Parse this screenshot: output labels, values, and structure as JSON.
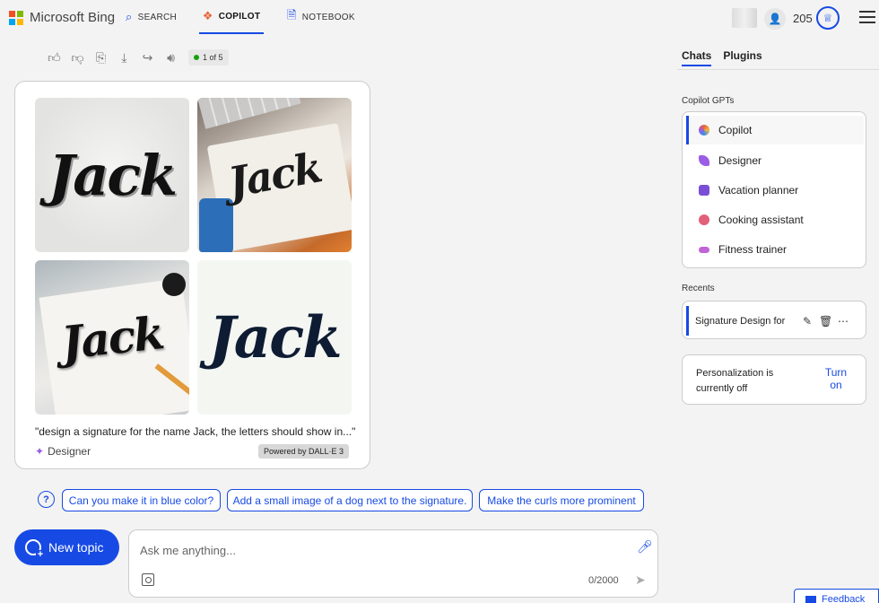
{
  "header": {
    "brand": "Microsoft Bing",
    "tabs": [
      {
        "label": "SEARCH",
        "icon": "search-icon"
      },
      {
        "label": "COPILOT",
        "icon": "copilot-icon",
        "active": true
      },
      {
        "label": "NOTEBOOK",
        "icon": "notebook-icon"
      }
    ],
    "points": "205",
    "accent_color": "#174ae4"
  },
  "response_actions": {
    "icons": [
      "thumbs-up-icon",
      "thumbs-down-icon",
      "copy-icon",
      "download-icon",
      "share-icon",
      "read-aloud-icon"
    ],
    "pager": "1 of 5"
  },
  "result_card": {
    "image_texts": [
      "Jack",
      "Jack",
      "Jack",
      "Jack"
    ],
    "prompt": "\"design a signature for the name Jack, the letters should show in...\"",
    "source": "Designer",
    "powered_by": "Powered by DALL·E 3"
  },
  "suggestions": [
    "Can you make it in blue color?",
    "Add a small image of a dog next to the signature.",
    "Make the curls more prominent"
  ],
  "composer": {
    "new_topic": "New topic",
    "placeholder": "Ask me anything...",
    "counter": "0/2000"
  },
  "sidebar": {
    "tabs": [
      "Chats",
      "Plugins"
    ],
    "gpts_title": "Copilot GPTs",
    "gpts": [
      {
        "label": "Copilot",
        "color": "#e8643c"
      },
      {
        "label": "Designer",
        "color": "#9b5de5"
      },
      {
        "label": "Vacation planner",
        "color": "#7a4fd8"
      },
      {
        "label": "Cooking assistant",
        "color": "#e2607a"
      },
      {
        "label": "Fitness trainer",
        "color": "#c064d6"
      }
    ],
    "recents_title": "Recents",
    "recents": [
      {
        "label": "Signature Design for"
      }
    ],
    "personalization": {
      "text": "Personalization is currently off",
      "button": "Turn on"
    },
    "feedback": "Feedback"
  }
}
